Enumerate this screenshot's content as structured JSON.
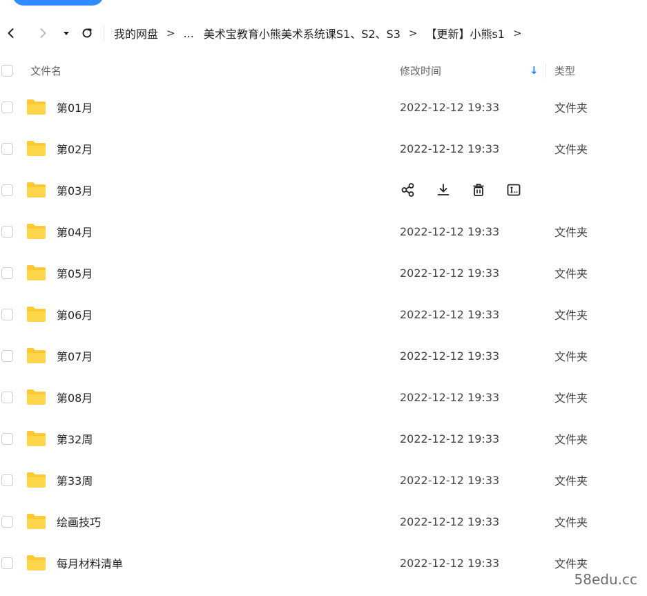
{
  "breadcrumb": {
    "items": [
      "我的网盘",
      "...",
      "美术宝教育小熊美术系统课S1、S2、S3",
      "【更新】小熊s1"
    ],
    "separator": ">"
  },
  "table": {
    "headers": {
      "name": "文件名",
      "modified": "修改时间",
      "type": "类型"
    },
    "rows": [
      {
        "name": "第01月",
        "modified": "2022-12-12 19:33",
        "type": "文件夹"
      },
      {
        "name": "第02月",
        "modified": "2022-12-12 19:33",
        "type": "文件夹"
      },
      {
        "name": "第03月",
        "modified": "",
        "type": "",
        "hovered": true
      },
      {
        "name": "第04月",
        "modified": "2022-12-12 19:33",
        "type": "文件夹"
      },
      {
        "name": "第05月",
        "modified": "2022-12-12 19:33",
        "type": "文件夹"
      },
      {
        "name": "第06月",
        "modified": "2022-12-12 19:33",
        "type": "文件夹"
      },
      {
        "name": "第07月",
        "modified": "2022-12-12 19:33",
        "type": "文件夹"
      },
      {
        "name": "第08月",
        "modified": "2022-12-12 19:33",
        "type": "文件夹"
      },
      {
        "name": "第32周",
        "modified": "2022-12-12 19:33",
        "type": "文件夹"
      },
      {
        "name": "第33周",
        "modified": "2022-12-12 19:33",
        "type": "文件夹"
      },
      {
        "name": "绘画技巧",
        "modified": "2022-12-12 19:33",
        "type": "文件夹"
      },
      {
        "name": "每月材料清单",
        "modified": "2022-12-12 19:33",
        "type": "文件夹"
      }
    ]
  },
  "row_actions": [
    "share-icon",
    "download-icon",
    "delete-icon",
    "rename-icon"
  ],
  "icons": {
    "back": "chevron-left-icon",
    "forward": "chevron-right-icon",
    "dropdown": "caret-down-icon",
    "refresh": "refresh-icon",
    "folder": "folder-icon",
    "sort": "arrow-down-icon"
  },
  "colors": {
    "accent": "#2f8cff",
    "sort_arrow": "#1a7cff",
    "folder": "#ffc933"
  },
  "watermark": "58edu.cc"
}
